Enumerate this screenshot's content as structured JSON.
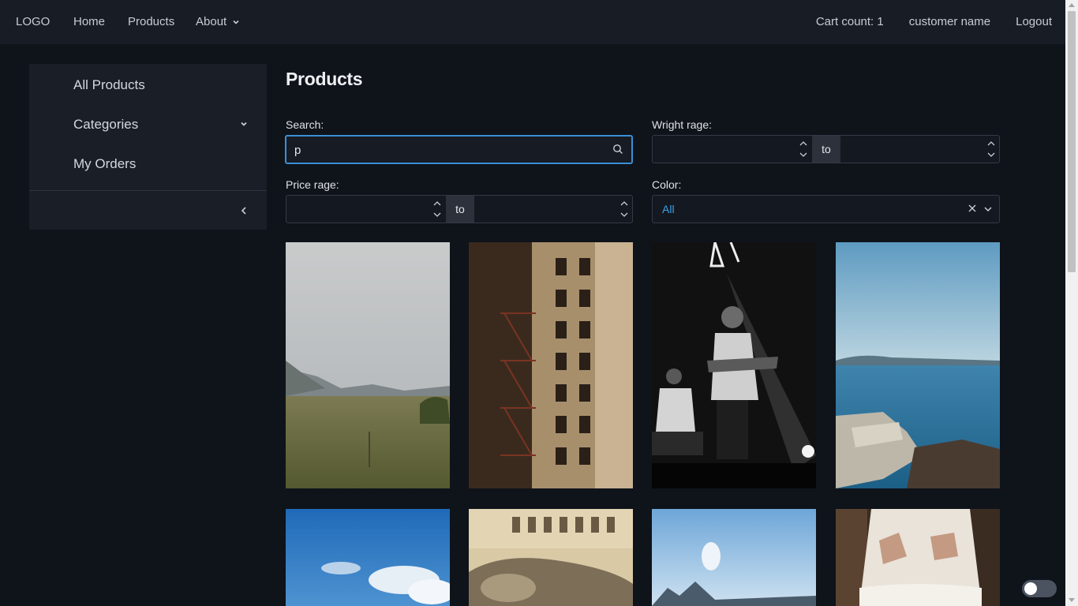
{
  "topnav": {
    "logo": "LOGO",
    "home": "Home",
    "products": "Products",
    "about": "About",
    "cart_count": "Cart count: 1",
    "customer_name": "customer name",
    "logout": "Logout"
  },
  "sidebar": {
    "items": [
      {
        "label": "All Products"
      },
      {
        "label": "Categories"
      },
      {
        "label": "My Orders"
      }
    ]
  },
  "main": {
    "title": "Products",
    "search": {
      "label": "Search:",
      "value": "p"
    },
    "weight": {
      "label": "Wright rage:",
      "to": "to"
    },
    "price": {
      "label": "Price rage:",
      "to": "to"
    },
    "color": {
      "label": "Color:",
      "value": "All"
    }
  },
  "colors": {
    "accent": "#3b8fd6",
    "select_value": "#3ea2e8",
    "background": "#0f131a",
    "navbar": "#181c24",
    "sidebar": "#1a1e27"
  },
  "products": [
    {
      "image": "landscape-grassland-photo"
    },
    {
      "image": "brick-building-fire-escape-photo"
    },
    {
      "image": "musician-concert-bw-photo"
    },
    {
      "image": "lake-rocks-photo"
    },
    {
      "image": "blue-sky-clouds-photo"
    },
    {
      "image": "vintage-car-street-photo"
    },
    {
      "image": "mountain-sky-photo"
    },
    {
      "image": "white-dress-forest-photo"
    }
  ]
}
